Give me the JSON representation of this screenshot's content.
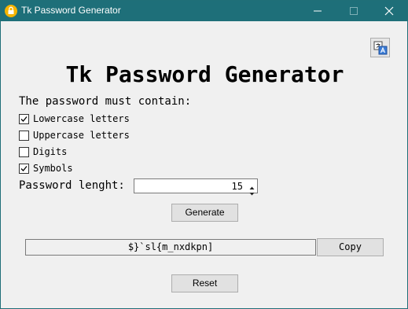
{
  "window": {
    "title": "Tk Password Generator",
    "accent_color": "#1e6f79",
    "icons": {
      "app": "padlock-icon",
      "minimize": "minimize-icon",
      "maximize": "maximize-icon",
      "close": "close-icon"
    }
  },
  "toolbar": {
    "language_icon": "language-translate-icon"
  },
  "main": {
    "heading": "Tk Password Generator",
    "options_label": "The password must contain:",
    "options": [
      {
        "label": "Lowercase letters",
        "checked": true
      },
      {
        "label": "Uppercase letters",
        "checked": false
      },
      {
        "label": "Digits",
        "checked": false
      },
      {
        "label": "Symbols",
        "checked": true
      }
    ],
    "length_label": "Password lenght:",
    "length_value": "15",
    "generate_label": "Generate",
    "password": "$}`sl{m_nxdkpn]",
    "copy_label": "Copy",
    "reset_label": "Reset"
  }
}
